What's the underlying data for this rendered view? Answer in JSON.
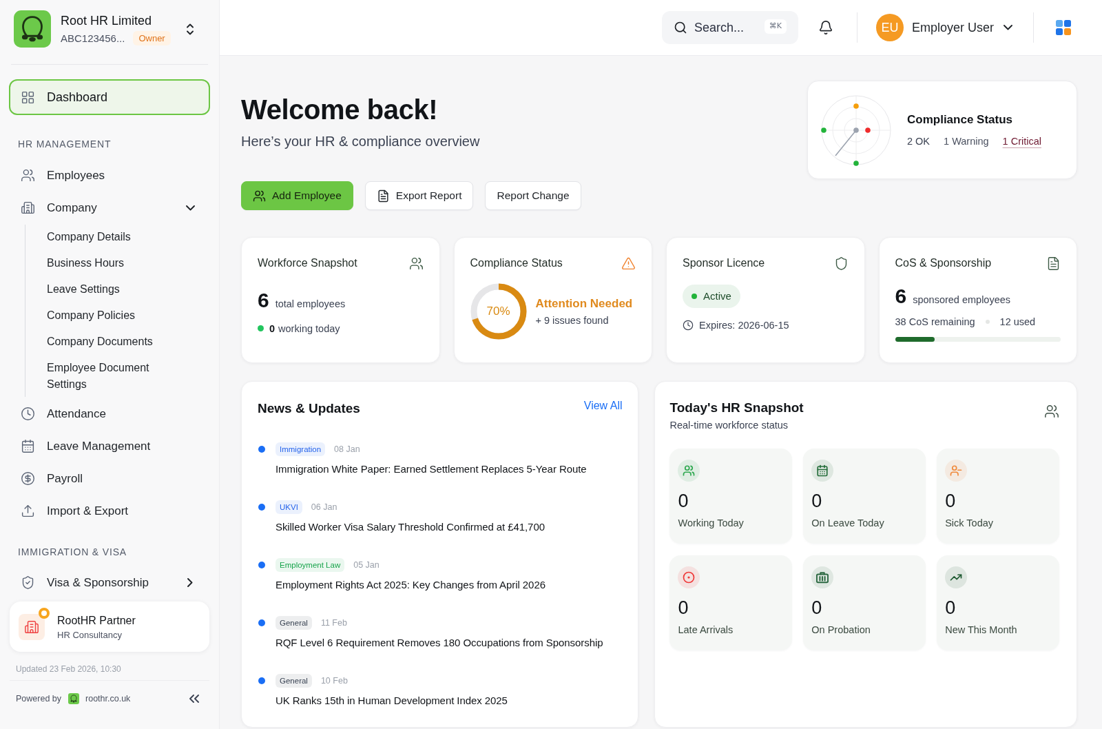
{
  "sidebar": {
    "org": {
      "name": "Root HR Limited",
      "id": "ABC123456...",
      "role": "Owner"
    },
    "nav": [
      {
        "label": "Dashboard",
        "selected": true
      }
    ],
    "sections": [
      {
        "title": "HR MANAGEMENT",
        "items": [
          {
            "label": "Employees",
            "selected": false
          },
          {
            "label": "Company",
            "selected": false,
            "expanded": true,
            "children": [
              {
                "label": "Company Details",
                "selected": false
              },
              {
                "label": "Business Hours",
                "selected": false
              },
              {
                "label": "Leave Settings",
                "selected": false
              },
              {
                "label": "Company Policies",
                "selected": false
              },
              {
                "label": "Company Documents",
                "selected": false
              },
              {
                "label": "Employee Document Settings",
                "selected": false
              }
            ]
          },
          {
            "label": "Attendance",
            "selected": false
          },
          {
            "label": "Leave Management",
            "selected": false
          },
          {
            "label": "Payroll",
            "selected": false
          },
          {
            "label": "Import & Export",
            "selected": false
          }
        ]
      },
      {
        "title": "IMMIGRATION & VISA",
        "items": [
          {
            "label": "Visa & Sponsorship",
            "selected": false,
            "expanded": false
          }
        ]
      }
    ],
    "partner": {
      "name": "RootHR Partner",
      "subtitle": "HR Consultancy"
    },
    "updated": "Updated 23 Feb 2026, 10:30",
    "footer": {
      "label": "Powered by",
      "link": "roothr.co.uk"
    }
  },
  "top_bar": {
    "search": {
      "placeholder": "Search...",
      "shortcut": "⌘K"
    },
    "user": {
      "initials": "EU",
      "name": "Employer User"
    }
  },
  "header": {
    "title": "Welcome back!",
    "subtitle": "Here’s your HR & compliance overview",
    "actions": [
      {
        "label": "Add Employee",
        "kind": "primary"
      },
      {
        "label": "Export Report",
        "kind": "secondary"
      },
      {
        "label": "Report Change",
        "kind": "secondary"
      }
    ]
  },
  "compliance_summary": {
    "title": "Compliance Status",
    "counts": [
      {
        "label": "2 OK",
        "kind": "ok"
      },
      {
        "label": "1 Warning",
        "kind": "warning"
      },
      {
        "label": "1 Critical",
        "kind": "critical"
      }
    ]
  },
  "cards": [
    {
      "kind": "workforce",
      "title": "Workforce Snapshot",
      "value": "6",
      "value_label": "total employees",
      "sub_value": "0",
      "sub_label": "working today"
    },
    {
      "kind": "compliance",
      "title": "Compliance Status",
      "percent": "70%",
      "level": 0.7,
      "status": "Attention Needed",
      "detail": "+ 9 issues found"
    },
    {
      "kind": "licence",
      "title": "Sponsor Licence",
      "status": "Active",
      "expires": "Expires: 2026-06-15"
    },
    {
      "kind": "cos",
      "title": "CoS & Sponsorship",
      "value": "6",
      "value_label": "sponsored employees",
      "remaining": "38 CoS remaining",
      "used": "12 used",
      "level": 0.24
    }
  ],
  "news": {
    "title": "News & Updates",
    "link": "View All",
    "items": [
      {
        "tag": "Immigration",
        "color": "#2563eb",
        "date": "08 Jan",
        "title": "Immigration White Paper: Earned Settlement Replaces 5-Year Route"
      },
      {
        "tag": "UKVI",
        "color": "#2563eb",
        "date": "06 Jan",
        "title": "Skilled Worker Visa Salary Threshold Confirmed at £41,700"
      },
      {
        "tag": "Employment Law",
        "color": "#16a34a",
        "date": "05 Jan",
        "title": "Employment Rights Act 2025: Key Changes from April 2026"
      },
      {
        "tag": "General",
        "color": "#374151",
        "date": "11 Feb",
        "title": "RQF Level 6 Requirement Removes 180 Occupations from Sponsorship"
      },
      {
        "tag": "General",
        "color": "#374151",
        "date": "10 Feb",
        "title": "UK Ranks 15th in Human Development Index 2025"
      }
    ]
  },
  "hr_snapshot": {
    "title": "Today's HR Snapshot",
    "subtitle": "Real-time workforce status",
    "tiles": [
      {
        "value": "0",
        "label": "Working Today",
        "color": "#2ea84f"
      },
      {
        "value": "0",
        "label": "On Leave Today",
        "color": "#256d3a"
      },
      {
        "value": "0",
        "label": "Sick Today",
        "color": "#f08a3c"
      },
      {
        "value": "0",
        "label": "Late Arrivals",
        "color": "#ef3b3b"
      },
      {
        "value": "0",
        "label": "On Probation",
        "color": "#2f6b44"
      },
      {
        "value": "0",
        "label": "New This Month",
        "color": "#1f5a32"
      }
    ]
  }
}
